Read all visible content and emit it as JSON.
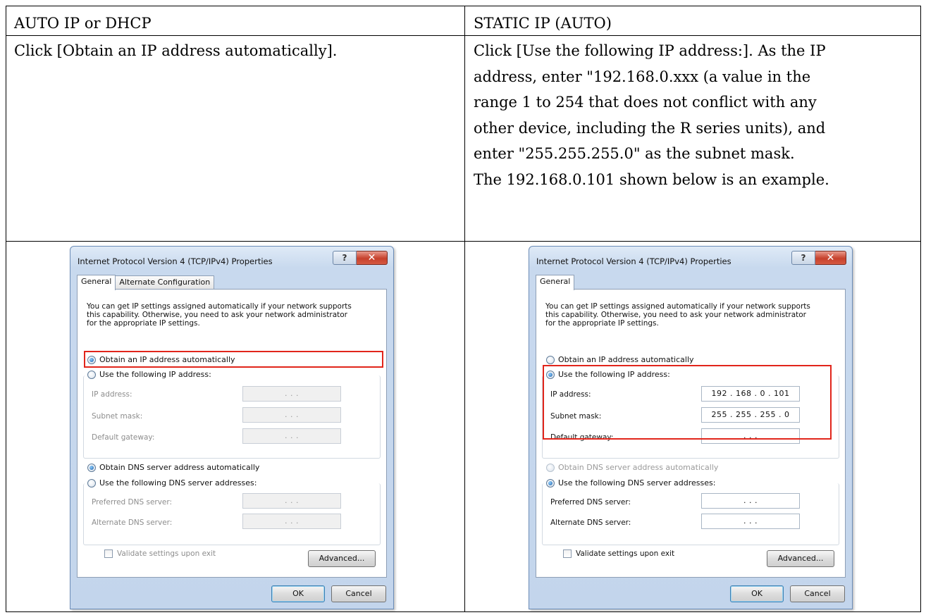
{
  "table": {
    "header_left": "AUTO IP or DHCP",
    "header_right": "STATIC IP (AUTO)",
    "body_left": "Click [Obtain an IP address automatically].",
    "body_right_lines": [
      "Click [Use the following IP address:]. As the IP",
      "address, enter \"192.168.0.xxx (a value in the",
      "range 1 to 254 that does not conflict with any",
      "other device, including the R series units), and",
      "enter \"255.255.255.0\" as the subnet mask.",
      "The 192.168.0.101 shown below is an example."
    ]
  },
  "dialog_left": {
    "title": "Internet Protocol Version 4 (TCP/IPv4) Properties",
    "help_label": "?",
    "close_label": "✕",
    "tabs": [
      "General",
      "Alternate Configuration"
    ],
    "intro": "You can get IP settings assigned automatically if your network supports\nthis capability. Otherwise, you need to ask your network administrator\nfor the appropriate IP settings.",
    "obtain_ip": "Obtain an IP address automatically",
    "use_ip": "Use the following IP address:",
    "ip_label": "IP address:",
    "subnet_label": "Subnet mask:",
    "gateway_label": "Default gateway:",
    "ip_value": ".   .   .",
    "subnet_value": ".   .   .",
    "gateway_value": ".   .   .",
    "obtain_dns": "Obtain DNS server address automatically",
    "use_dns": "Use the following DNS server addresses:",
    "preferred_dns_label": "Preferred DNS server:",
    "alternate_dns_label": "Alternate DNS server:",
    "preferred_dns_value": ".   .   .",
    "alternate_dns_value": ".   .   .",
    "validate": "Validate settings upon exit",
    "advanced": "Advanced...",
    "ok": "OK",
    "cancel": "Cancel",
    "selected_ip_mode": "obtain",
    "selected_dns_mode": "obtain"
  },
  "dialog_right": {
    "title": "Internet Protocol Version 4 (TCP/IPv4) Properties",
    "help_label": "?",
    "close_label": "✕",
    "tabs": [
      "General"
    ],
    "intro": "You can get IP settings assigned automatically if your network supports\nthis capability. Otherwise, you need to ask your network administrator\nfor the appropriate IP settings.",
    "obtain_ip": "Obtain an IP address automatically",
    "use_ip": "Use the following IP address:",
    "ip_label": "IP address:",
    "subnet_label": "Subnet mask:",
    "gateway_label": "Default gateway:",
    "ip_value": "192 . 168 .  0  . 101",
    "subnet_value": "255 . 255 . 255 .  0",
    "gateway_value": ".   .   .",
    "obtain_dns": "Obtain DNS server address automatically",
    "use_dns": "Use the following DNS server addresses:",
    "preferred_dns_label": "Preferred DNS server:",
    "alternate_dns_label": "Alternate DNS server:",
    "preferred_dns_value": ".   .   .",
    "alternate_dns_value": ".   .   .",
    "validate": "Validate settings upon exit",
    "advanced": "Advanced...",
    "ok": "OK",
    "cancel": "Cancel",
    "selected_ip_mode": "use",
    "selected_dns_mode": "use"
  },
  "colors": {
    "highlight": "#e1251b",
    "dialog_border": "#6c8db8",
    "close_button": "#c6412c"
  }
}
